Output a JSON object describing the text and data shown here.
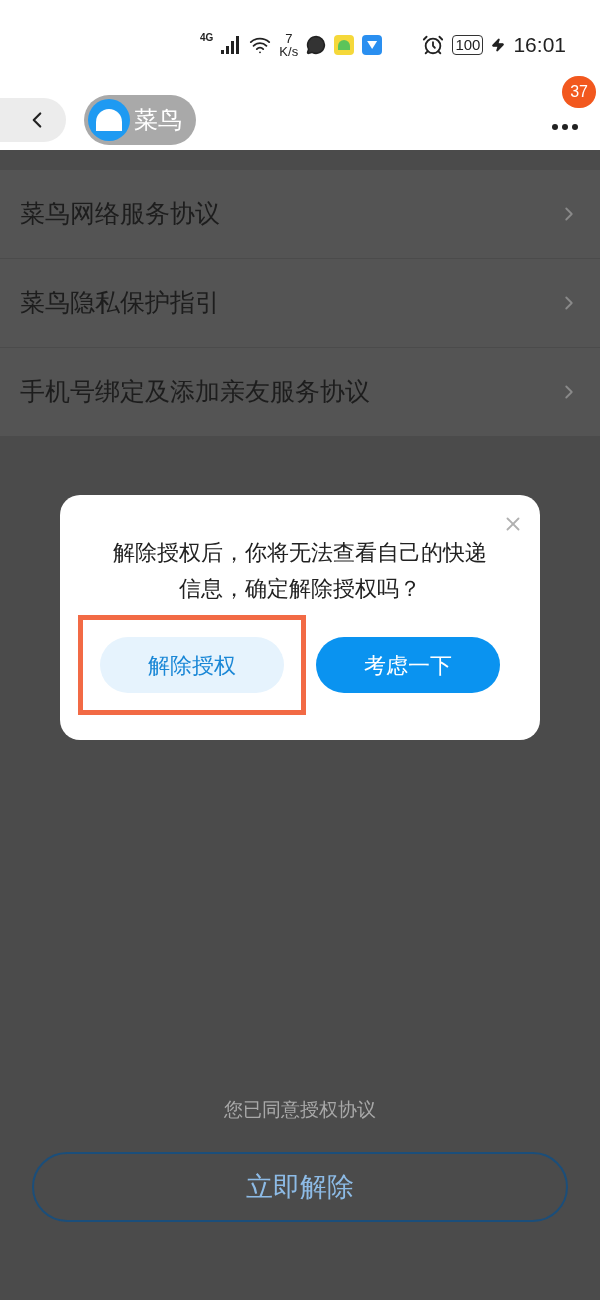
{
  "status_bar": {
    "network": "4G",
    "speed_value": "7",
    "speed_unit": "K/s",
    "battery": "100",
    "time": "16:01"
  },
  "header": {
    "app_name": "菜鸟",
    "badge": "37"
  },
  "agreements": [
    {
      "label": "菜鸟网络服务协议"
    },
    {
      "label": "菜鸟隐私保护指引"
    },
    {
      "label": "手机号绑定及添加亲友服务协议"
    }
  ],
  "consent_note": "您已同意授权协议",
  "revoke_button": "立即解除",
  "dialog": {
    "message": "解除授权后，你将无法查看自己的快递信息，确定解除授权吗？",
    "buttons": [
      {
        "label": "解除授权",
        "kind": "secondary",
        "highlighted": true
      },
      {
        "label": "考虑一下",
        "kind": "primary",
        "highlighted": false
      }
    ]
  }
}
